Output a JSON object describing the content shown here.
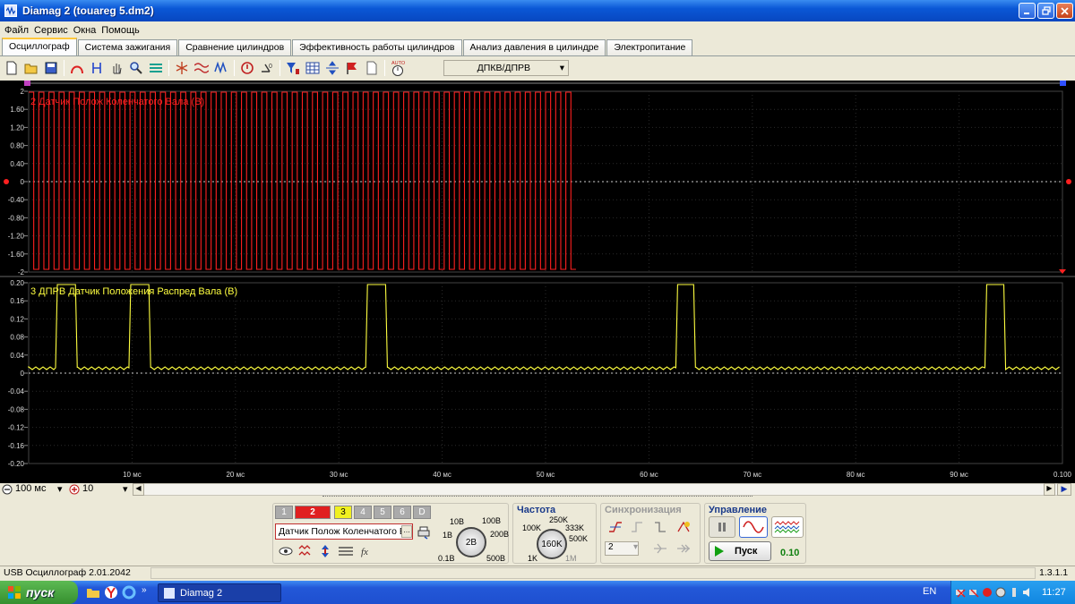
{
  "window": {
    "title": "Diamag 2 (touareg 5.dm2)"
  },
  "menu": [
    "Файл",
    "Сервис",
    "Окна",
    "Помощь"
  ],
  "tabs": [
    {
      "label": "Осциллограф",
      "active": true
    },
    {
      "label": "Система зажигания"
    },
    {
      "label": "Сравнение цилиндров"
    },
    {
      "label": "Эффективность работы цилиндров"
    },
    {
      "label": "Анализ давления в цилиндре"
    },
    {
      "label": "Электропитание"
    }
  ],
  "toolbar": {
    "dropdown_value": "ДПКВ/ДПРВ",
    "auto_label": "AUTO"
  },
  "channel2": {
    "label": "2 Датчик Полож Коленчатого Вала (В)",
    "color": "#ff2020",
    "y_ticks": [
      "2",
      "1.60",
      "1.20",
      "0.80",
      "0.40",
      "0",
      "-0.40",
      "-0.80",
      "-1.20",
      "-1.60",
      "-2"
    ]
  },
  "channel3": {
    "label": "3 ДПРВ Датчик Положения Распред Вала (В)",
    "color": "#ffff40",
    "y_ticks": [
      "0.20",
      "0.16",
      "0.12",
      "0.08",
      "0.04",
      "0",
      "-0.04",
      "-0.08",
      "-0.12",
      "-0.16",
      "-0.20"
    ]
  },
  "x_ticks": [
    "10 мс",
    "20 мс",
    "30 мс",
    "40 мс",
    "50 мс",
    "60 мс",
    "70 мс",
    "80 мс",
    "90 мс",
    "0.100"
  ],
  "timebase": {
    "value": "100 мс",
    "divisions": "10"
  },
  "channels": {
    "buttons": [
      "1",
      "2",
      "3",
      "4",
      "5",
      "6",
      "D"
    ],
    "selected_sensor": "Датчик Полож Коленчатого В",
    "volt_labels": {
      "v10": "10В",
      "v100": "100В",
      "v1": "1В",
      "v200": "200В",
      "v01": "0.1В",
      "v500": "500В",
      "knob": "2В"
    }
  },
  "frequency": {
    "title": "Частота",
    "labels": {
      "f250": "250K",
      "f100": "100K",
      "f333": "333K",
      "f500": "500K",
      "f1": "1K",
      "f1m": "1M",
      "knob": "160K"
    }
  },
  "sync": {
    "title": "Синхронизация",
    "channel": "2"
  },
  "control": {
    "title": "Управление",
    "run_label": "Пуск",
    "value": "0.10"
  },
  "status": {
    "left": "USB Осциллограф  2.01.2042",
    "right": "1.3.1.1"
  },
  "taskbar": {
    "start": "пуск",
    "task": "Diamag 2",
    "lang": "EN",
    "clock": "11:27"
  }
}
